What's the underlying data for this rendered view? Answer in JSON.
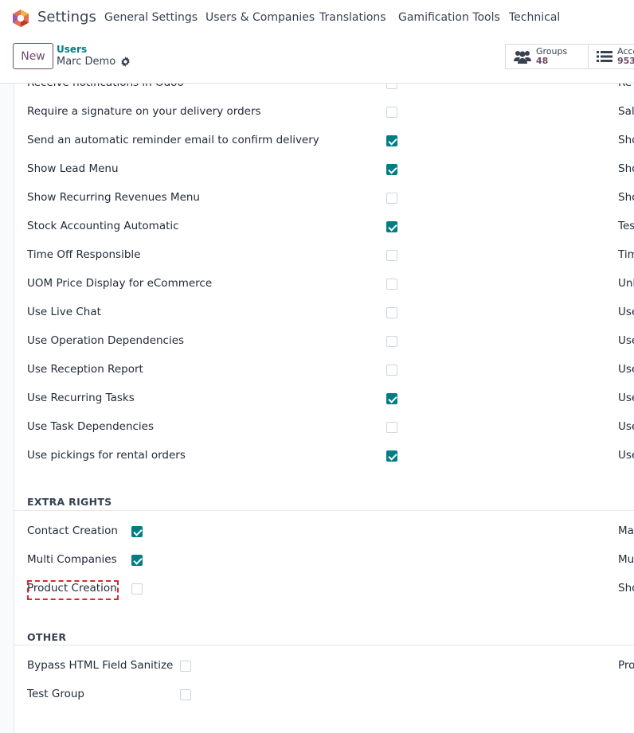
{
  "app": {
    "name": "Settings"
  },
  "menu": [
    "General Settings",
    "Users & Companies",
    "Translations",
    "Gamification Tools",
    "Technical"
  ],
  "control_panel": {
    "new_label": "New",
    "breadcrumb_parent": "Users",
    "breadcrumb_current": "Marc Demo",
    "smart_buttons": [
      {
        "label": "Groups",
        "value": "48"
      },
      {
        "label": "Acce",
        "value": "953"
      }
    ]
  },
  "rights": {
    "rows": [
      {
        "label": "Receive notifications in Odoo",
        "checked": false,
        "right": "Re"
      },
      {
        "label": "Require a signature on your delivery orders",
        "checked": false,
        "right": "Sal"
      },
      {
        "label": "Send an automatic reminder email to confirm delivery",
        "checked": true,
        "right": "Sho"
      },
      {
        "label": "Show Lead Menu",
        "checked": true,
        "right": "Sho"
      },
      {
        "label": "Show Recurring Revenues Menu",
        "checked": false,
        "right": "Sho"
      },
      {
        "label": "Stock Accounting Automatic",
        "checked": true,
        "right": "Tes"
      },
      {
        "label": "Time Off Responsible",
        "checked": false,
        "right": "Tim"
      },
      {
        "label": "UOM Price Display for eCommerce",
        "checked": false,
        "right": "Unl"
      },
      {
        "label": "Use Live Chat",
        "checked": false,
        "right": "Use"
      },
      {
        "label": "Use Operation Dependencies",
        "checked": false,
        "right": "Use"
      },
      {
        "label": "Use Reception Report",
        "checked": false,
        "right": "Use"
      },
      {
        "label": "Use Recurring Tasks",
        "checked": true,
        "right": "Use"
      },
      {
        "label": "Use Task Dependencies",
        "checked": false,
        "right": "Use"
      },
      {
        "label": "Use pickings for rental orders",
        "checked": true,
        "right": "Use"
      }
    ]
  },
  "extra_rights": {
    "title": "EXTRA RIGHTS",
    "rows": [
      {
        "label": "Contact Creation",
        "checked": true,
        "right": "Ma"
      },
      {
        "label": "Multi Companies",
        "checked": true,
        "right": "Mu"
      },
      {
        "label": "Product Creation",
        "checked": false,
        "right": "Sho"
      }
    ]
  },
  "other": {
    "title": "OTHER",
    "rows": [
      {
        "label": "Bypass HTML Field Sanitize",
        "checked": false,
        "right": "Pro"
      },
      {
        "label": "Test Group",
        "checked": false,
        "right": ""
      }
    ]
  },
  "colors": {
    "brand": "#714b67",
    "accent": "#017e84",
    "focus": "#e0262e"
  }
}
